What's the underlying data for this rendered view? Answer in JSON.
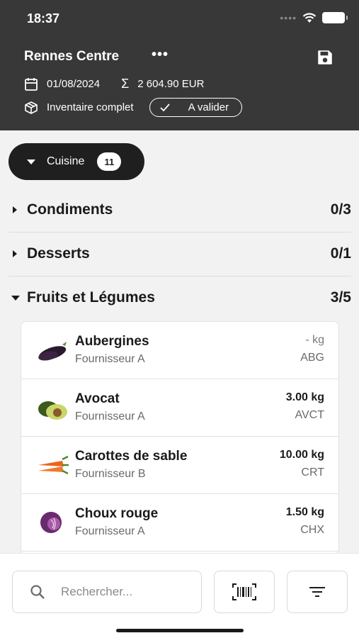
{
  "status_bar": {
    "time": "18:37"
  },
  "header": {
    "title": "Rennes Centre",
    "more_label": "•••",
    "date": "01/08/2024",
    "sigma_symbol": "Σ",
    "total": "2 604.90 EUR",
    "inventory_type": "Inventaire complet",
    "status_badge": "A valider"
  },
  "category": {
    "label": "Cuisine",
    "count": "11"
  },
  "sections": [
    {
      "name": "Condiments",
      "count": "0/3",
      "expanded": false
    },
    {
      "name": "Desserts",
      "count": "0/1",
      "expanded": false
    },
    {
      "name": "Fruits et Légumes",
      "count": "3/5",
      "expanded": true
    }
  ],
  "items": [
    {
      "name": "Aubergines",
      "supplier": "Fournisseur A",
      "quantity": "- kg",
      "code": "ABG",
      "icon": "eggplant-icon"
    },
    {
      "name": "Avocat",
      "supplier": "Fournisseur A",
      "quantity": "3.00 kg",
      "code": "AVCT",
      "icon": "avocado-icon"
    },
    {
      "name": "Carottes de sable",
      "supplier": "Fournisseur B",
      "quantity": "10.00 kg",
      "code": "CRT",
      "icon": "carrot-icon"
    },
    {
      "name": "Choux rouge",
      "supplier": "Fournisseur A",
      "quantity": "1.50 kg",
      "code": "CHX",
      "icon": "red-cabbage-icon"
    }
  ],
  "search": {
    "placeholder": "Rechercher..."
  },
  "colors": {
    "header_bg": "#383838",
    "pill_bg": "#1f1f1f",
    "page_bg": "#f2f2f2"
  }
}
